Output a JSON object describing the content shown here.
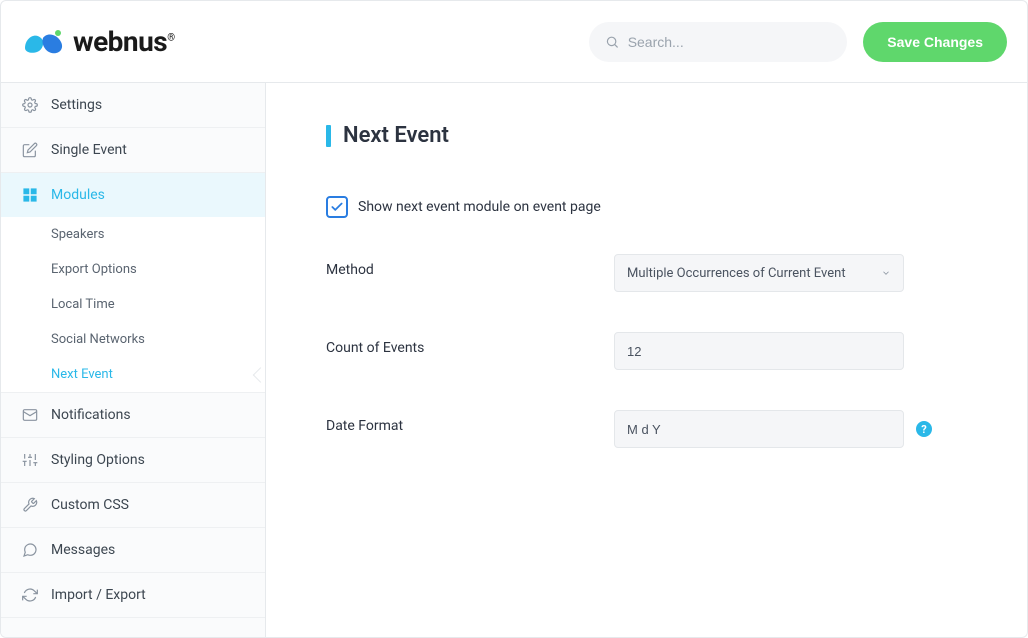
{
  "header": {
    "brand": "webnus",
    "search_placeholder": "Search...",
    "save_label": "Save Changes"
  },
  "sidebar": {
    "items": [
      {
        "label": "Settings",
        "icon": "gear"
      },
      {
        "label": "Single Event",
        "icon": "edit"
      },
      {
        "label": "Modules",
        "icon": "grid",
        "active": true
      },
      {
        "label": "Notifications",
        "icon": "mail"
      },
      {
        "label": "Styling Options",
        "icon": "sliders"
      },
      {
        "label": "Custom CSS",
        "icon": "wrench"
      },
      {
        "label": "Messages",
        "icon": "chat"
      },
      {
        "label": "Import / Export",
        "icon": "refresh"
      }
    ],
    "subitems": [
      {
        "label": "Speakers"
      },
      {
        "label": "Export Options"
      },
      {
        "label": "Local Time"
      },
      {
        "label": "Social Networks"
      },
      {
        "label": "Next Event",
        "active": true
      }
    ]
  },
  "page": {
    "title": "Next Event",
    "checkbox_label": "Show next event module on event page",
    "fields": {
      "method": {
        "label": "Method",
        "value": "Multiple Occurrences of Current Event"
      },
      "count": {
        "label": "Count of Events",
        "value": "12"
      },
      "format": {
        "label": "Date Format",
        "value": "M d Y"
      }
    }
  }
}
